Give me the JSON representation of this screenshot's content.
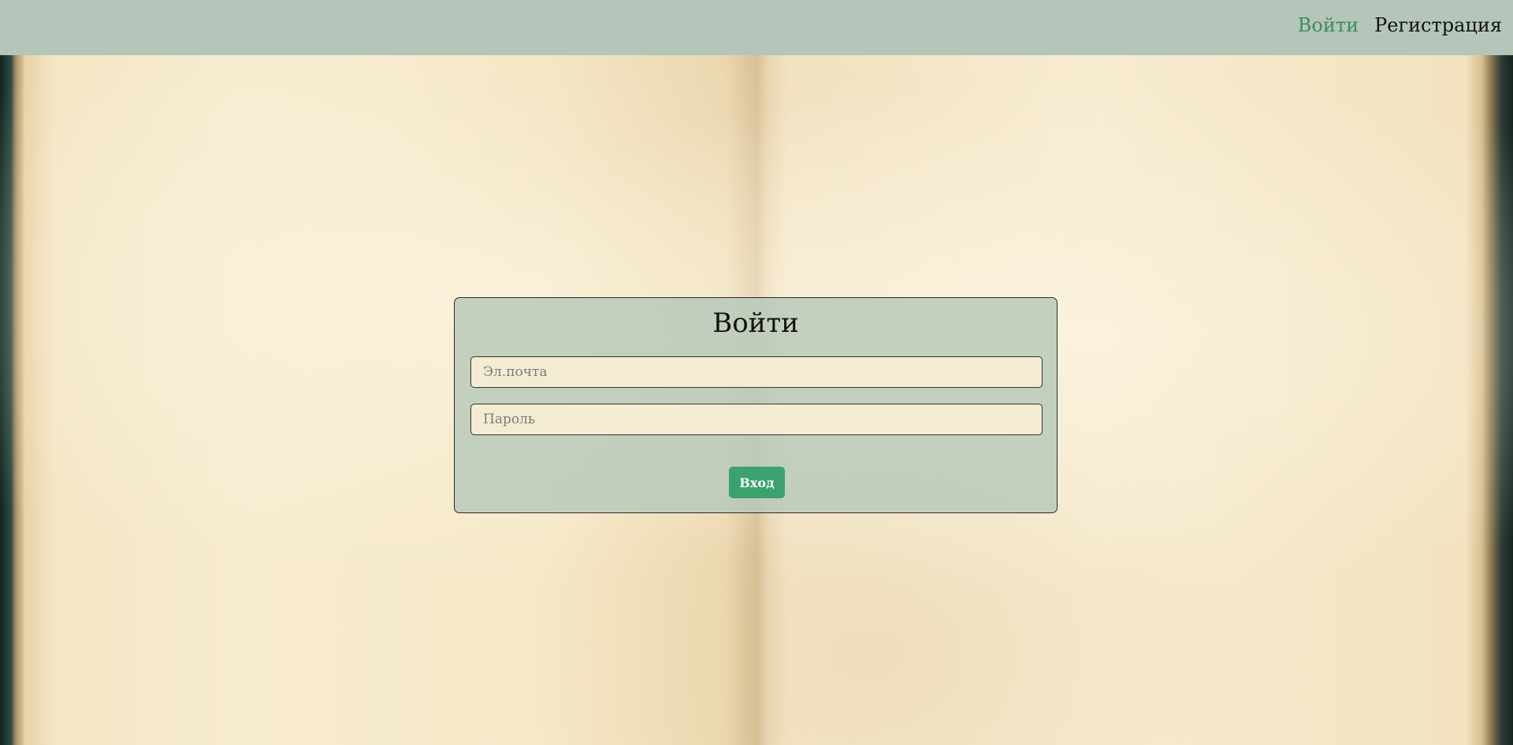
{
  "header": {
    "nav": {
      "login": "Войти",
      "register": "Регистрация"
    }
  },
  "login_form": {
    "title": "Войти",
    "email_placeholder": "Эл.почта",
    "password_placeholder": "Пароль",
    "submit_label": "Вход"
  },
  "colors": {
    "header_bg": "#b4c6b9",
    "active_link": "#3d8a66",
    "button_bg": "#39a26f",
    "input_bg": "#f3ecd2"
  }
}
